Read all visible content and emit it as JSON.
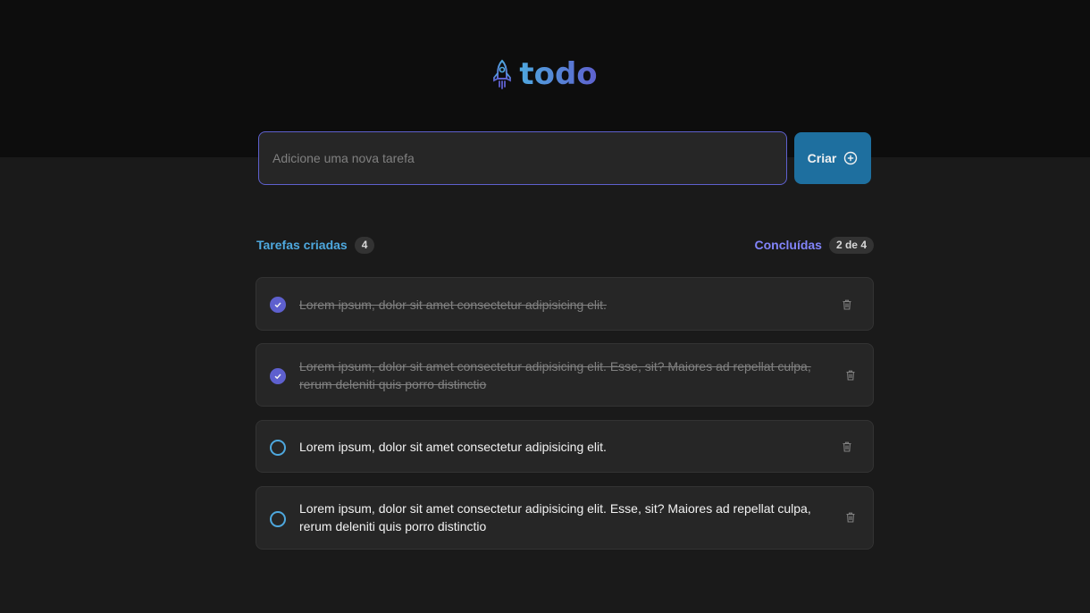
{
  "app": {
    "logo_text": "todo",
    "logo_icon": "rocket-icon",
    "brand_colors": {
      "blue": "#4ea8de",
      "purple": "#5e60ce",
      "button": "#1e6f9f"
    }
  },
  "new_task": {
    "placeholder": "Adicione uma nova tarefa",
    "value": "",
    "create_label": "Criar",
    "create_icon": "plus-circle-icon"
  },
  "stats": {
    "created_label": "Tarefas criadas",
    "created_count": "4",
    "done_label": "Concluídas",
    "done_count": "2 de 4"
  },
  "tasks": [
    {
      "text": "Lorem ipsum, dolor sit amet consectetur adipisicing elit.",
      "done": true
    },
    {
      "text": "Lorem ipsum, dolor sit amet consectetur adipisicing elit. Esse, sit? Maiores ad repellat culpa, rerum deleniti quis porro distinctio",
      "done": true
    },
    {
      "text": "Lorem ipsum, dolor sit amet consectetur adipisicing elit.",
      "done": false
    },
    {
      "text": "Lorem ipsum, dolor sit amet consectetur adipisicing elit. Esse, sit? Maiores ad repellat culpa, rerum deleniti quis porro distinctio",
      "done": false
    }
  ]
}
